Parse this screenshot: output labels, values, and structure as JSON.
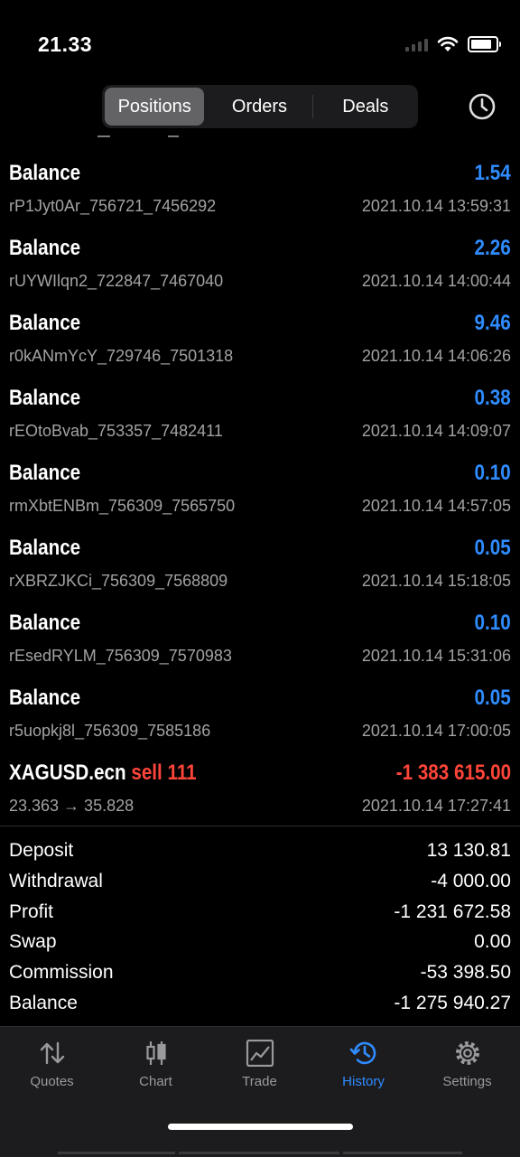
{
  "status": {
    "time": "21.33"
  },
  "segments": [
    {
      "label": "Positions",
      "active": true
    },
    {
      "label": "Orders",
      "active": false
    },
    {
      "label": "Deals",
      "active": false
    }
  ],
  "deals": [
    {
      "type": "Balance",
      "amount": "1.54",
      "id": "rP1Jyt0Ar_756721_7456292",
      "date": "2021.10.14 13:59:31"
    },
    {
      "type": "Balance",
      "amount": "2.26",
      "id": "rUYWIlqn2_722847_7467040",
      "date": "2021.10.14 14:00:44"
    },
    {
      "type": "Balance",
      "amount": "9.46",
      "id": "r0kANmYcY_729746_7501318",
      "date": "2021.10.14 14:06:26"
    },
    {
      "type": "Balance",
      "amount": "0.38",
      "id": "rEOtoBvab_753357_7482411",
      "date": "2021.10.14 14:09:07"
    },
    {
      "type": "Balance",
      "amount": "0.10",
      "id": "rmXbtENBm_756309_7565750",
      "date": "2021.10.14 14:57:05"
    },
    {
      "type": "Balance",
      "amount": "0.05",
      "id": "rXBRZJKCi_756309_7568809",
      "date": "2021.10.14 15:18:05"
    },
    {
      "type": "Balance",
      "amount": "0.10",
      "id": "rEsedRYLM_756309_7570983",
      "date": "2021.10.14 15:31:06"
    },
    {
      "type": "Balance",
      "amount": "0.05",
      "id": "r5uopkj8l_756309_7585186",
      "date": "2021.10.14 17:00:05"
    }
  ],
  "trade": {
    "symbol": "XAGUSD.ecn",
    "side": "sell 111",
    "amount": "-1 383 615.00",
    "prices": "23.363 → 35.828",
    "date": "2021.10.14 17:27:41"
  },
  "summary": [
    {
      "label": "Deposit",
      "value": "13 130.81"
    },
    {
      "label": "Withdrawal",
      "value": "-4 000.00"
    },
    {
      "label": "Profit",
      "value": "-1 231 672.58"
    },
    {
      "label": "Swap",
      "value": "0.00"
    },
    {
      "label": "Commission",
      "value": "-53 398.50"
    },
    {
      "label": "Balance",
      "value": "-1 275 940.27"
    }
  ],
  "tabs": [
    {
      "label": "Quotes",
      "icon": "quotes-icon",
      "active": false
    },
    {
      "label": "Chart",
      "icon": "candlestick-icon",
      "active": false
    },
    {
      "label": "Trade",
      "icon": "trade-chart-icon",
      "active": false
    },
    {
      "label": "History",
      "icon": "history-icon",
      "active": true
    },
    {
      "label": "Settings",
      "icon": "gear-icon",
      "active": false
    }
  ],
  "colors": {
    "accent": "#2f8cff",
    "negative": "#ff453a",
    "background": "#000000"
  }
}
